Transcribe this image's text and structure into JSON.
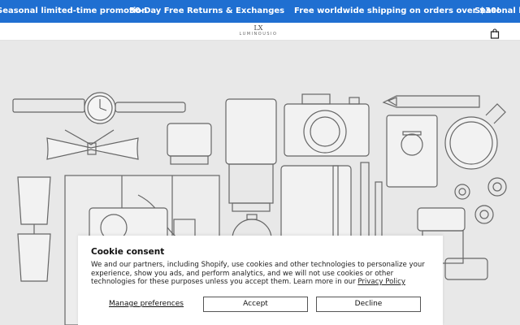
{
  "announcement": {
    "messages": [
      "Seasonal limited-time promotion",
      "30-Day Free Returns & Exchanges",
      "Free worldwide shipping on orders over $30!",
      "Seasonal limit"
    ],
    "background": "#1f6fd1"
  },
  "header": {
    "logo_mark": "LX",
    "logo_word": "LUMINOUSIO",
    "cart_icon": "shopping-bag-icon"
  },
  "cookie": {
    "title": "Cookie consent",
    "body": "We and our partners, including Shopify, use cookies and other technologies to personalize your experience, show you ads, and perform analytics, and we will not use cookies or other technologies for these purposes unless you accept them. Learn more in our ",
    "privacy_link": "Privacy Policy",
    "manage_label": "Manage preferences",
    "accept_label": "Accept",
    "decline_label": "Decline"
  }
}
